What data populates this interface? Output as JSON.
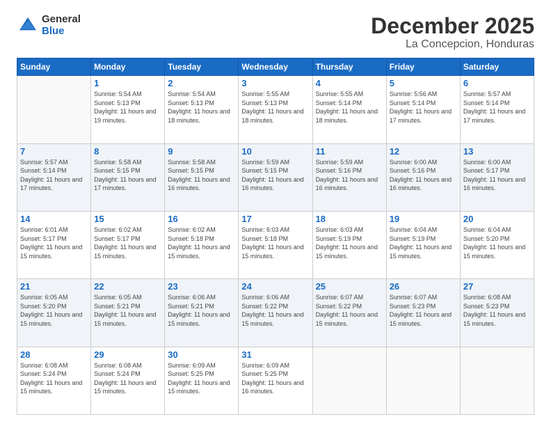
{
  "logo": {
    "general": "General",
    "blue": "Blue"
  },
  "header": {
    "month": "December 2025",
    "location": "La Concepcion, Honduras"
  },
  "weekdays": [
    "Sunday",
    "Monday",
    "Tuesday",
    "Wednesday",
    "Thursday",
    "Friday",
    "Saturday"
  ],
  "weeks": [
    [
      {
        "day": "",
        "sunrise": "",
        "sunset": "",
        "daylight": ""
      },
      {
        "day": "1",
        "sunrise": "Sunrise: 5:54 AM",
        "sunset": "Sunset: 5:13 PM",
        "daylight": "Daylight: 11 hours and 19 minutes."
      },
      {
        "day": "2",
        "sunrise": "Sunrise: 5:54 AM",
        "sunset": "Sunset: 5:13 PM",
        "daylight": "Daylight: 11 hours and 18 minutes."
      },
      {
        "day": "3",
        "sunrise": "Sunrise: 5:55 AM",
        "sunset": "Sunset: 5:13 PM",
        "daylight": "Daylight: 11 hours and 18 minutes."
      },
      {
        "day": "4",
        "sunrise": "Sunrise: 5:55 AM",
        "sunset": "Sunset: 5:14 PM",
        "daylight": "Daylight: 11 hours and 18 minutes."
      },
      {
        "day": "5",
        "sunrise": "Sunrise: 5:56 AM",
        "sunset": "Sunset: 5:14 PM",
        "daylight": "Daylight: 11 hours and 17 minutes."
      },
      {
        "day": "6",
        "sunrise": "Sunrise: 5:57 AM",
        "sunset": "Sunset: 5:14 PM",
        "daylight": "Daylight: 11 hours and 17 minutes."
      }
    ],
    [
      {
        "day": "7",
        "sunrise": "Sunrise: 5:57 AM",
        "sunset": "Sunset: 5:14 PM",
        "daylight": "Daylight: 11 hours and 17 minutes."
      },
      {
        "day": "8",
        "sunrise": "Sunrise: 5:58 AM",
        "sunset": "Sunset: 5:15 PM",
        "daylight": "Daylight: 11 hours and 17 minutes."
      },
      {
        "day": "9",
        "sunrise": "Sunrise: 5:58 AM",
        "sunset": "Sunset: 5:15 PM",
        "daylight": "Daylight: 11 hours and 16 minutes."
      },
      {
        "day": "10",
        "sunrise": "Sunrise: 5:59 AM",
        "sunset": "Sunset: 5:15 PM",
        "daylight": "Daylight: 11 hours and 16 minutes."
      },
      {
        "day": "11",
        "sunrise": "Sunrise: 5:59 AM",
        "sunset": "Sunset: 5:16 PM",
        "daylight": "Daylight: 11 hours and 16 minutes."
      },
      {
        "day": "12",
        "sunrise": "Sunrise: 6:00 AM",
        "sunset": "Sunset: 5:16 PM",
        "daylight": "Daylight: 11 hours and 16 minutes."
      },
      {
        "day": "13",
        "sunrise": "Sunrise: 6:00 AM",
        "sunset": "Sunset: 5:17 PM",
        "daylight": "Daylight: 11 hours and 16 minutes."
      }
    ],
    [
      {
        "day": "14",
        "sunrise": "Sunrise: 6:01 AM",
        "sunset": "Sunset: 5:17 PM",
        "daylight": "Daylight: 11 hours and 15 minutes."
      },
      {
        "day": "15",
        "sunrise": "Sunrise: 6:02 AM",
        "sunset": "Sunset: 5:17 PM",
        "daylight": "Daylight: 11 hours and 15 minutes."
      },
      {
        "day": "16",
        "sunrise": "Sunrise: 6:02 AM",
        "sunset": "Sunset: 5:18 PM",
        "daylight": "Daylight: 11 hours and 15 minutes."
      },
      {
        "day": "17",
        "sunrise": "Sunrise: 6:03 AM",
        "sunset": "Sunset: 5:18 PM",
        "daylight": "Daylight: 11 hours and 15 minutes."
      },
      {
        "day": "18",
        "sunrise": "Sunrise: 6:03 AM",
        "sunset": "Sunset: 5:19 PM",
        "daylight": "Daylight: 11 hours and 15 minutes."
      },
      {
        "day": "19",
        "sunrise": "Sunrise: 6:04 AM",
        "sunset": "Sunset: 5:19 PM",
        "daylight": "Daylight: 11 hours and 15 minutes."
      },
      {
        "day": "20",
        "sunrise": "Sunrise: 6:04 AM",
        "sunset": "Sunset: 5:20 PM",
        "daylight": "Daylight: 11 hours and 15 minutes."
      }
    ],
    [
      {
        "day": "21",
        "sunrise": "Sunrise: 6:05 AM",
        "sunset": "Sunset: 5:20 PM",
        "daylight": "Daylight: 11 hours and 15 minutes."
      },
      {
        "day": "22",
        "sunrise": "Sunrise: 6:05 AM",
        "sunset": "Sunset: 5:21 PM",
        "daylight": "Daylight: 11 hours and 15 minutes."
      },
      {
        "day": "23",
        "sunrise": "Sunrise: 6:06 AM",
        "sunset": "Sunset: 5:21 PM",
        "daylight": "Daylight: 11 hours and 15 minutes."
      },
      {
        "day": "24",
        "sunrise": "Sunrise: 6:06 AM",
        "sunset": "Sunset: 5:22 PM",
        "daylight": "Daylight: 11 hours and 15 minutes."
      },
      {
        "day": "25",
        "sunrise": "Sunrise: 6:07 AM",
        "sunset": "Sunset: 5:22 PM",
        "daylight": "Daylight: 11 hours and 15 minutes."
      },
      {
        "day": "26",
        "sunrise": "Sunrise: 6:07 AM",
        "sunset": "Sunset: 5:23 PM",
        "daylight": "Daylight: 11 hours and 15 minutes."
      },
      {
        "day": "27",
        "sunrise": "Sunrise: 6:08 AM",
        "sunset": "Sunset: 5:23 PM",
        "daylight": "Daylight: 11 hours and 15 minutes."
      }
    ],
    [
      {
        "day": "28",
        "sunrise": "Sunrise: 6:08 AM",
        "sunset": "Sunset: 5:24 PM",
        "daylight": "Daylight: 11 hours and 15 minutes."
      },
      {
        "day": "29",
        "sunrise": "Sunrise: 6:08 AM",
        "sunset": "Sunset: 5:24 PM",
        "daylight": "Daylight: 11 hours and 15 minutes."
      },
      {
        "day": "30",
        "sunrise": "Sunrise: 6:09 AM",
        "sunset": "Sunset: 5:25 PM",
        "daylight": "Daylight: 11 hours and 15 minutes."
      },
      {
        "day": "31",
        "sunrise": "Sunrise: 6:09 AM",
        "sunset": "Sunset: 5:25 PM",
        "daylight": "Daylight: 11 hours and 16 minutes."
      },
      {
        "day": "",
        "sunrise": "",
        "sunset": "",
        "daylight": ""
      },
      {
        "day": "",
        "sunrise": "",
        "sunset": "",
        "daylight": ""
      },
      {
        "day": "",
        "sunrise": "",
        "sunset": "",
        "daylight": ""
      }
    ]
  ]
}
